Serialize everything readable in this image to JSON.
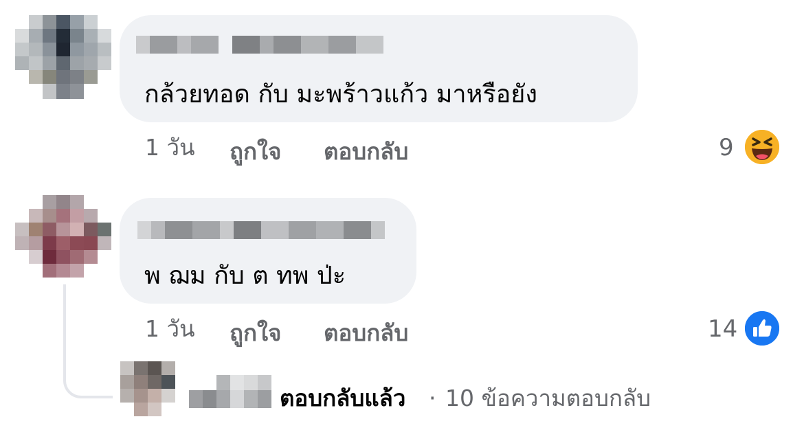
{
  "comments": [
    {
      "text": "กล้วยทอด กับ มะพร้าวแก้ว มาหรือยัง",
      "time": "1 วัน",
      "like_label": "ถูกใจ",
      "reply_label": "ตอบกลับ",
      "reaction_count": "9",
      "reaction_icon": "haha-emoji-icon"
    },
    {
      "text": "พ ฌม กับ ต ทพ ป่ะ",
      "time": "1 วัน",
      "like_label": "ถูกใจ",
      "reply_label": "ตอบกลับ",
      "reaction_count": "14",
      "reaction_icon": "like-thumb-icon"
    }
  ],
  "replies_summary": {
    "replied_label": "ตอบกลับแล้ว",
    "separator": "·",
    "reply_count_label": "10 ข้อความตอบกลับ"
  },
  "colors": {
    "bubble": "#f0f2f5",
    "text": "#050505",
    "secondary_text": "#65676b",
    "like_blue": "#1877f2",
    "haha_yellow": "#f7b125"
  }
}
